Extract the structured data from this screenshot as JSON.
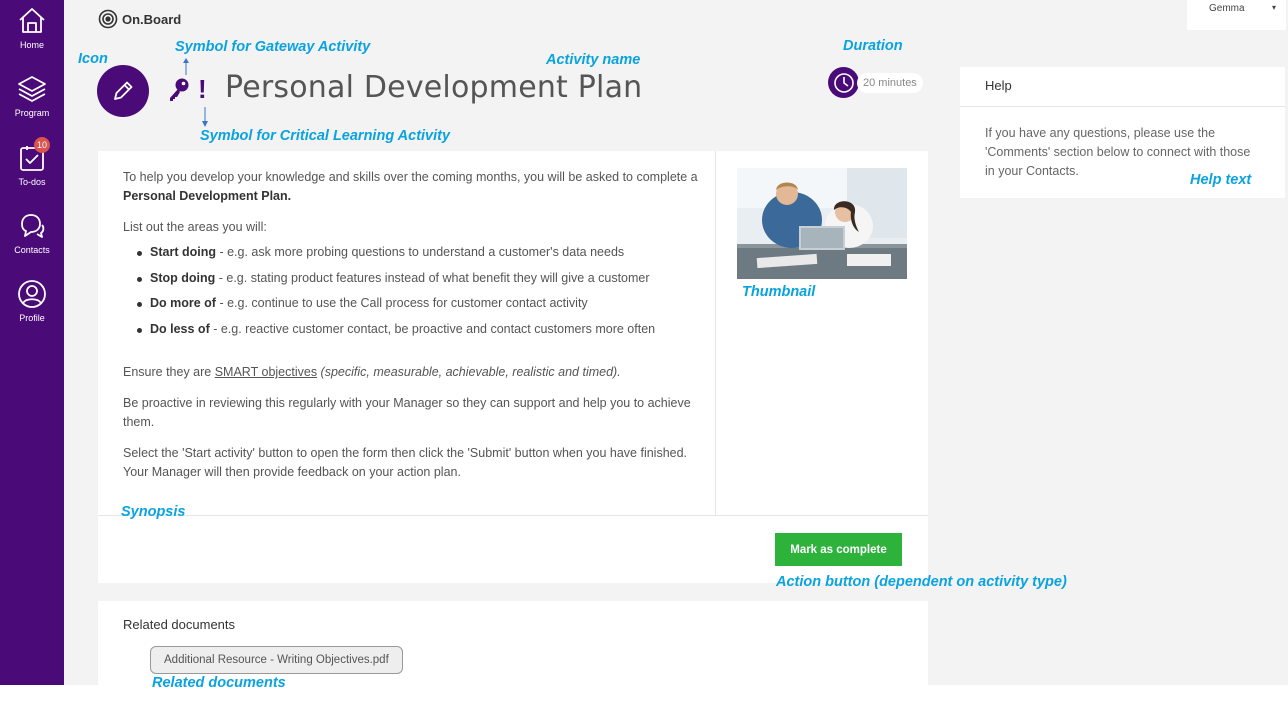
{
  "sidebar": {
    "items": [
      {
        "label": "Home",
        "icon": "home-icon"
      },
      {
        "label": "Program",
        "icon": "layers-icon"
      },
      {
        "label": "To-dos",
        "icon": "checklist-icon",
        "badge": "10"
      },
      {
        "label": "Contacts",
        "icon": "chat-icon"
      },
      {
        "label": "Profile",
        "icon": "user-icon"
      }
    ]
  },
  "header": {
    "logo_text": "On.Board",
    "user_name": "Gemma",
    "user_caret": "▾"
  },
  "activity": {
    "title": "Personal Development Plan",
    "icon": "pencil-icon",
    "gateway_symbol": "key-icon",
    "critical_symbol": "!",
    "duration": "20 minutes"
  },
  "synopsis": {
    "intro_plain": "To help you develop your knowledge and skills over the coming months, you will be asked to complete a ",
    "intro_bold": "Personal Development Plan.",
    "list_intro": "List out the areas you will:",
    "items": [
      {
        "bold": "Start doing",
        "text": " - e.g. ask more probing questions to understand a customer's data needs"
      },
      {
        "bold": "Stop doing",
        "text": " - e.g. stating product features instead of what benefit they will give a customer"
      },
      {
        "bold": "Do more of",
        "text": " - e.g. continue to use the Call process for customer contact activity"
      },
      {
        "bold": "Do less of",
        "text": " - e.g. reactive customer contact, be proactive and contact customers more often"
      }
    ],
    "smart_prefix": "Ensure they are ",
    "smart_link": "SMART objectives",
    "smart_italic": " (specific, measurable, achievable, realistic and timed).",
    "proactive": "Be proactive in reviewing this regularly with your Manager so they can support and help you to achieve them.",
    "instructions": "Select the 'Start activity' button to open the form then click the 'Submit' button when you have finished. Your Manager will then provide feedback on your action plan."
  },
  "action_button": "Mark as complete",
  "related_documents": {
    "title": "Related documents",
    "files": [
      "Additional Resource - Writing Objectives.pdf"
    ]
  },
  "help": {
    "title": "Help",
    "text": "If you have any questions, please use the 'Comments' section below to connect with those in your Contacts."
  },
  "annotations": {
    "icon": "Icon",
    "gateway": "Symbol for Gateway Activity",
    "activity_name": "Activity name",
    "duration": "Duration",
    "critical": "Symbol for Critical Learning Activity",
    "thumbnail": "Thumbnail",
    "help_text": "Help text",
    "synopsis": "Synopsis",
    "action_button": "Action button (dependent on activity type)",
    "related_documents": "Related documents"
  },
  "colors": {
    "brand_purple": "#4a0a78",
    "action_green": "#2db33c",
    "annotation_blue": "#0aa3e0",
    "badge_red": "#d9534f"
  }
}
